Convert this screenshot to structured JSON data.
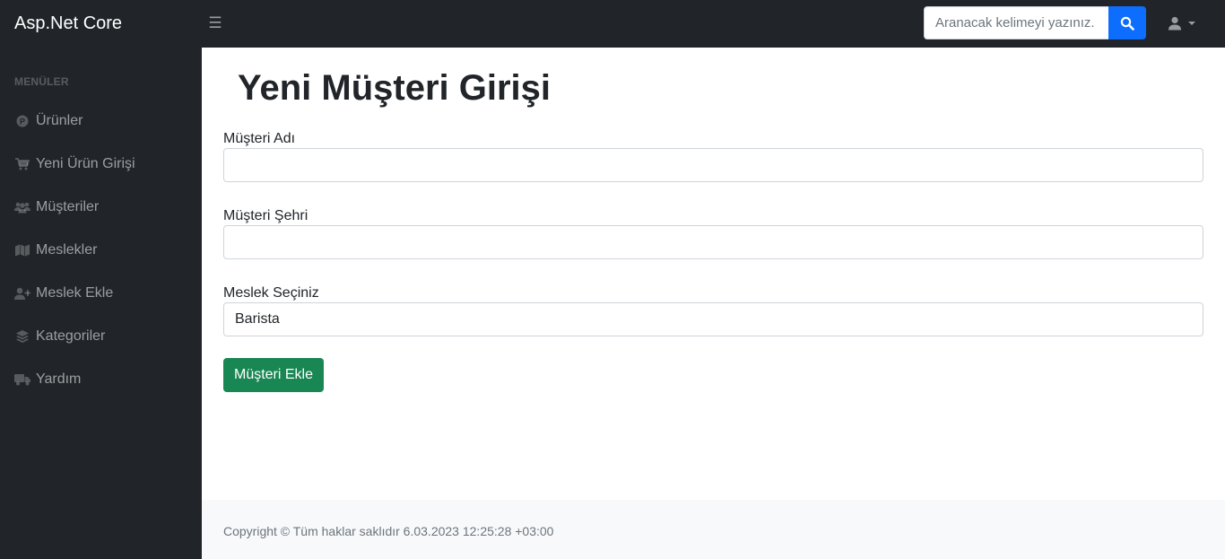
{
  "app": {
    "brand": "Asp.Net Core"
  },
  "header": {
    "toggle_icon": "bars-icon",
    "search": {
      "placeholder": "Aranacak kelimeyi yazınız.",
      "value": "",
      "icon": "search-icon"
    },
    "user_icon": "user-icon"
  },
  "sidebar": {
    "heading": "MENÜLER",
    "items": [
      {
        "label": "Ürünler",
        "icon": "product-icon"
      },
      {
        "label": "Yeni Ürün Girişi",
        "icon": "cart-icon"
      },
      {
        "label": "Müşteriler",
        "icon": "users-icon"
      },
      {
        "label": "Meslekler",
        "icon": "map-icon"
      },
      {
        "label": "Meslek Ekle",
        "icon": "user-plus-icon"
      },
      {
        "label": "Kategoriler",
        "icon": "layers-icon"
      },
      {
        "label": "Yardım",
        "icon": "truck-icon"
      }
    ]
  },
  "main": {
    "title": "Yeni Müşteri Girişi",
    "form": {
      "name_label": "Müşteri Adı",
      "name_value": "",
      "city_label": "Müşteri Şehri",
      "city_value": "",
      "job_label": "Meslek Seçiniz",
      "job_selected": "Barista",
      "submit_label": "Müşteri Ekle"
    }
  },
  "footer": {
    "copyright": "Copyright © Tüm haklar saklıdır 6.03.2023 12:25:28 +03:00"
  },
  "colors": {
    "dark": "#212529",
    "primary": "#0d6efd",
    "success": "#198754",
    "footer_bg": "#f8f9fa"
  }
}
